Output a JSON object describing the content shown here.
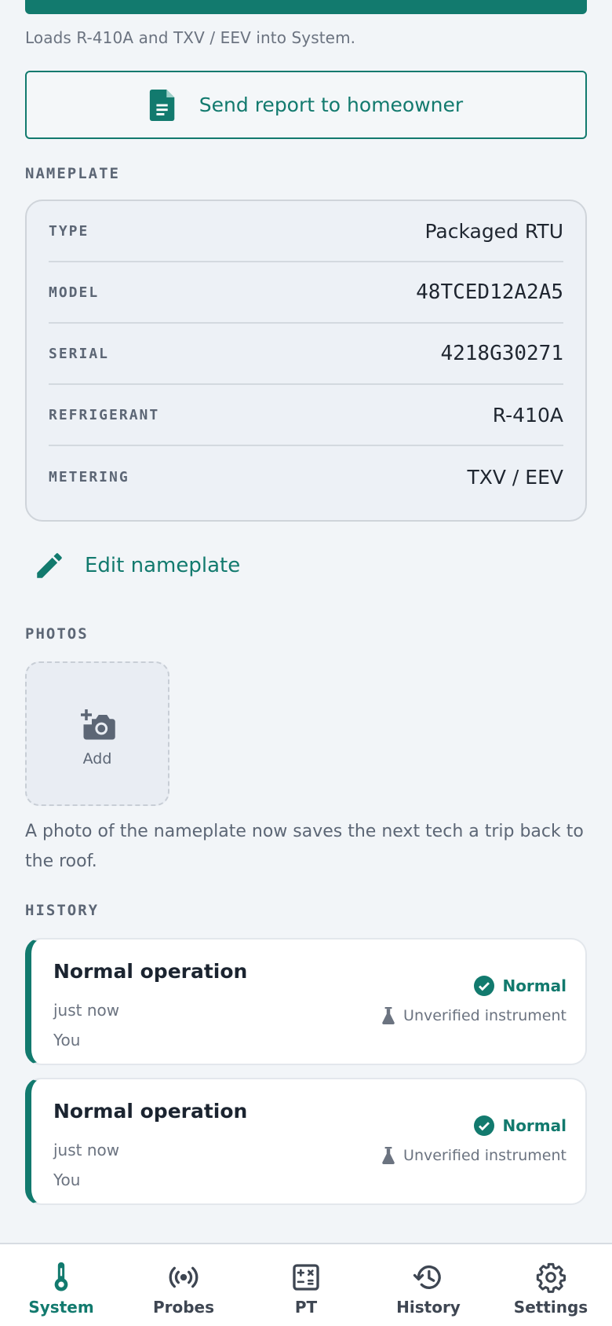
{
  "header": {
    "loads_text": "Loads R-410A and TXV / EEV into System.",
    "send_report_label": "Send report to homeowner"
  },
  "nameplate": {
    "section_label": "NAMEPLATE",
    "rows": [
      {
        "key": "TYPE",
        "value": "Packaged RTU"
      },
      {
        "key": "MODEL",
        "value": "48TCED12A2A5"
      },
      {
        "key": "SERIAL",
        "value": "4218G30271"
      },
      {
        "key": "REFRIGERANT",
        "value": "R-410A"
      },
      {
        "key": "METERING",
        "value": "TXV / EEV"
      }
    ],
    "edit_label": "Edit nameplate"
  },
  "photos": {
    "section_label": "PHOTOS",
    "add_label": "Add",
    "hint": "A photo of the nameplate now saves the next tech a trip back to the roof."
  },
  "history": {
    "section_label": "HISTORY",
    "entries": [
      {
        "title": "Normal operation",
        "time": "just now",
        "who": "You",
        "status": "Normal",
        "instrument": "Unverified instrument"
      },
      {
        "title": "Normal operation",
        "time": "just now",
        "who": "You",
        "status": "Normal",
        "instrument": "Unverified instrument"
      }
    ]
  },
  "nav": {
    "items": [
      {
        "label": "System",
        "icon": "thermometer-icon",
        "active": true
      },
      {
        "label": "Probes",
        "icon": "probe-signal-icon",
        "active": false
      },
      {
        "label": "PT",
        "icon": "calculator-icon",
        "active": false
      },
      {
        "label": "History",
        "icon": "history-icon",
        "active": false
      },
      {
        "label": "Settings",
        "icon": "gear-icon",
        "active": false
      }
    ]
  },
  "colors": {
    "accent": "#127a6e",
    "background": "#f2f5f8",
    "muted_text": "#6b7380"
  }
}
